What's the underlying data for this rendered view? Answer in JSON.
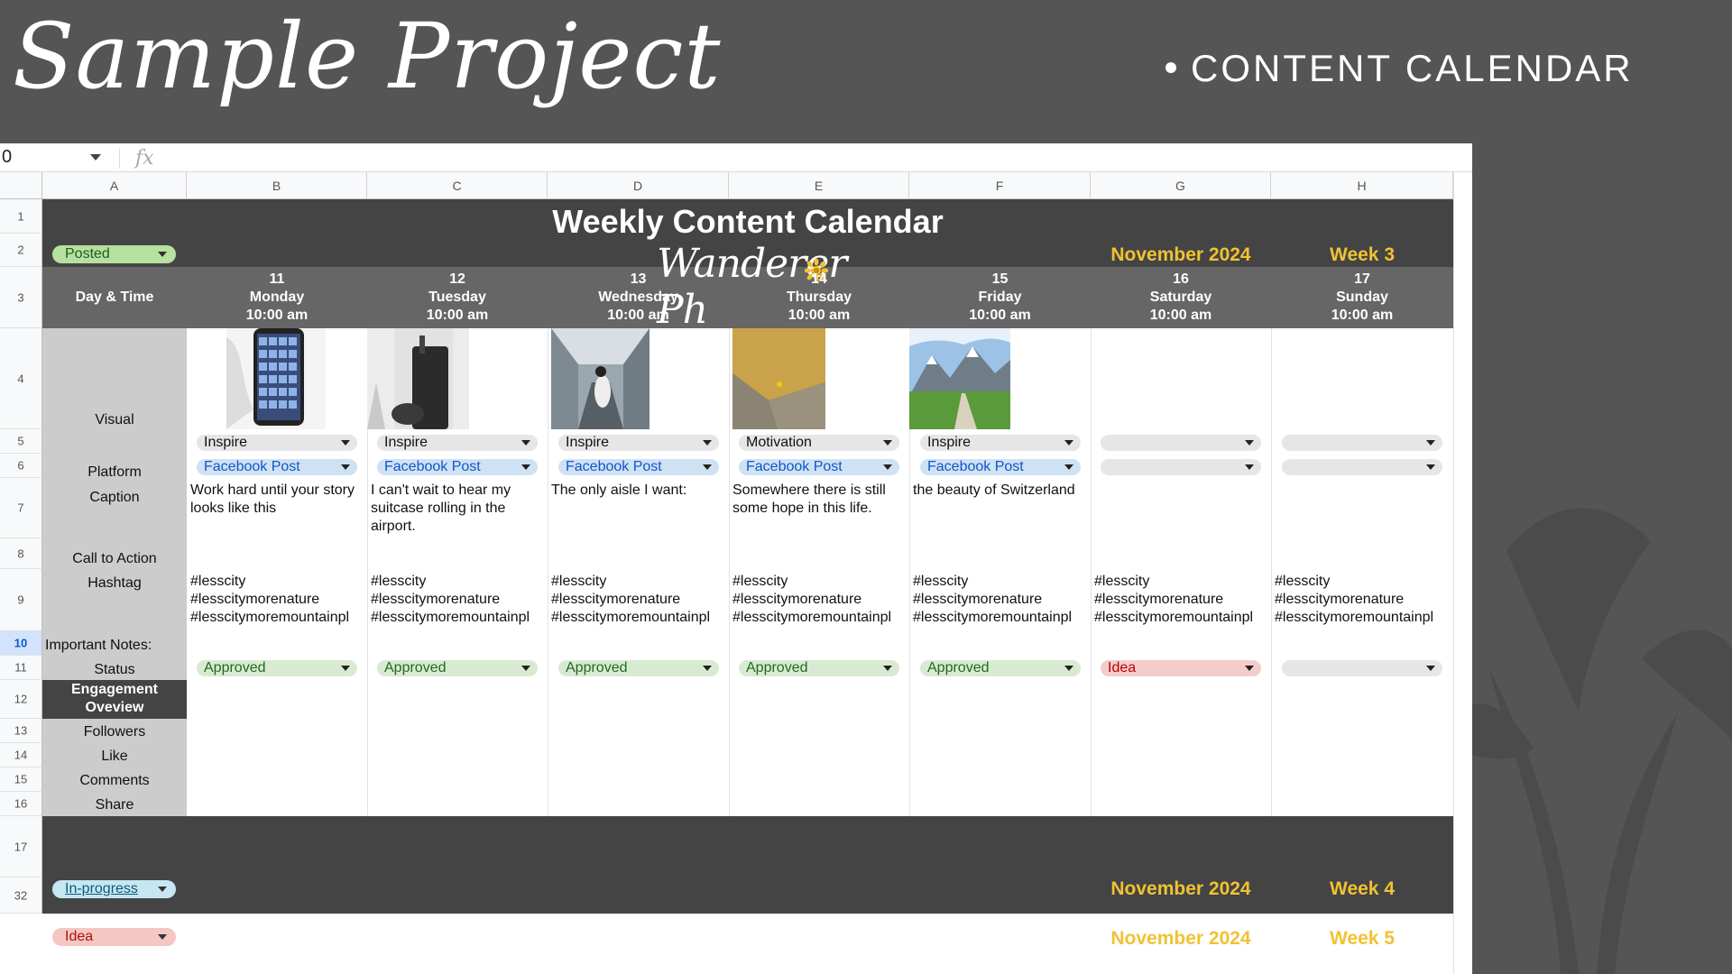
{
  "slide": {
    "title": "Sample Project",
    "subtitle": "CONTENT CALENDAR"
  },
  "toolbar": {
    "namebox": "0",
    "fx": "fx"
  },
  "columns": [
    "A",
    "B",
    "C",
    "D",
    "E",
    "F",
    "G",
    "H"
  ],
  "rows": [
    "1",
    "2",
    "3",
    "4",
    "5",
    "6",
    "7",
    "8",
    "9",
    "10",
    "11",
    "12",
    "13",
    "14",
    "15",
    "16",
    "17",
    "32"
  ],
  "calendar": {
    "title": "Weekly Content Calendar",
    "brand": "Wanderer Ph",
    "week1": {
      "status": "Posted",
      "month": "November 2024",
      "week": "Week 3"
    },
    "week2": {
      "status": "In-progress",
      "month": "November 2024",
      "week": "Week 4"
    },
    "week3": {
      "status": "Idea",
      "month": "November 2024",
      "week": "Week 5"
    }
  },
  "labels": {
    "day_time": "Day & Time",
    "visual": "Visual",
    "platform": "Platform",
    "caption": "Caption",
    "cta": "Call to Action",
    "hashtag": "Hashtag",
    "notes": "Important Notes:",
    "status": "Status",
    "engagement": "Engagement Oveview",
    "followers": "Followers",
    "like": "Like",
    "comments": "Comments",
    "share": "Share"
  },
  "days": [
    {
      "date": "11",
      "day": "Monday",
      "time": "10:00 am",
      "type": "Inspire",
      "platform": "Facebook Post",
      "caption": "Work hard until your story looks like this",
      "hashtag": "#lesscity #lesscitymorenature #lesscitymoremountainpl ease #lesscitylights",
      "status": "Approved",
      "visual": "phone-photo-thumbnail"
    },
    {
      "date": "12",
      "day": "Tuesday",
      "time": "10:00 am",
      "type": "Inspire",
      "platform": "Facebook Post",
      "caption": "I can't wait to hear my suitcase rolling in the airport.",
      "hashtag": "#lesscity #lesscitymorenature #lesscitymoremountainpl ease #lesscitylights",
      "status": "Approved",
      "visual": "suitcase-photo-thumbnail"
    },
    {
      "date": "13",
      "day": "Wednesday",
      "time": "10:00 am",
      "type": "Inspire",
      "platform": "Facebook Post",
      "caption": "The only aisle I want:",
      "hashtag": "#lesscity #lesscitymorenature #lesscitymoremountainpl ease #lesscitylights",
      "status": "Approved",
      "visual": "airplane-aisle-thumbnail"
    },
    {
      "date": "14",
      "day": "Thursday",
      "time": "10:00 am",
      "type": "Motivation",
      "platform": "Facebook Post",
      "caption": "Somewhere there is still some hope in this life.",
      "hashtag": "#lesscity #lesscitymorenature #lesscitymoremountainpl ease #lesscitylights",
      "status": "Approved",
      "visual": "rock-flower-thumbnail"
    },
    {
      "date": "15",
      "day": "Friday",
      "time": "10:00 am",
      "type": "Inspire",
      "platform": "Facebook Post",
      "caption": "the beauty of Switzerland",
      "hashtag": "#lesscity #lesscitymorenature #lesscitymoremountainpl ease #lesscitylights",
      "status": "Approved",
      "visual": "mountain-valley-thumbnail"
    },
    {
      "date": "16",
      "day": "Saturday",
      "time": "10:00 am",
      "type": "",
      "platform": "",
      "caption": "",
      "hashtag": "#lesscity #lesscitymorenature #lesscitymoremountainpl ease #lesscitylights",
      "status": "Idea",
      "visual": ""
    },
    {
      "date": "17",
      "day": "Sunday",
      "time": "10:00 am",
      "type": "",
      "platform": "",
      "caption": "",
      "hashtag": "#lesscity #lesscitymorenature #lesscitymoremountainpl ease #lesscitylights",
      "status": "",
      "visual": ""
    }
  ],
  "colors": {
    "band": "#444444",
    "gold": "#f1c232",
    "label_bg": "#cccccc",
    "slide_bg": "#555555"
  }
}
